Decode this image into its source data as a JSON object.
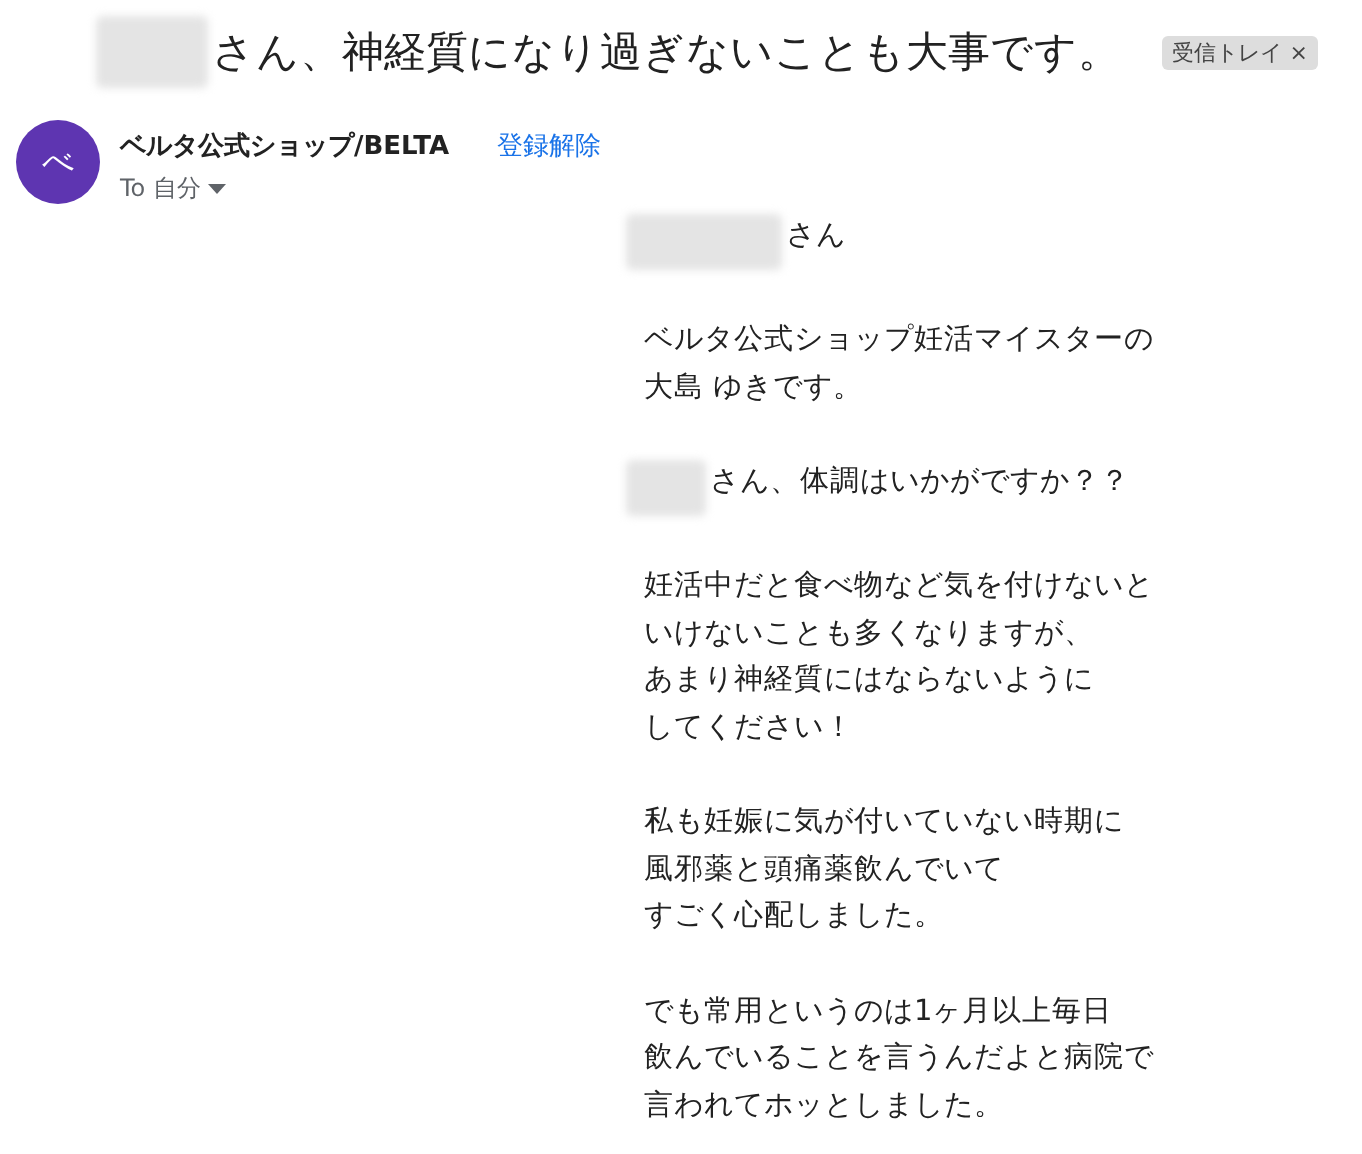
{
  "subject": {
    "redacted": true,
    "text": "さん、神経質になり過ぎないことも大事です。"
  },
  "label": {
    "text": "受信トレイ",
    "close": "×"
  },
  "sender": {
    "avatar": "べ",
    "name": "ベルタ公式ショップ/BELTA",
    "unsubscribe": "登録解除",
    "to": "To 自分"
  },
  "body": [
    {
      "redacted": true,
      "lines": [
        "さん"
      ]
    },
    {
      "redacted": false,
      "lines": [
        "ベルタ公式ショップ妊活マイスターの",
        "大島 ゆきです。"
      ]
    },
    {
      "redacted": true,
      "lines": [
        "さん、体調はいかがですか？？"
      ]
    },
    {
      "redacted": false,
      "lines": [
        "妊活中だと食べ物など気を付けないと",
        "いけないことも多くなりますが、",
        "あまり神経質にはならないように",
        "してください！"
      ]
    },
    {
      "redacted": false,
      "lines": [
        "私も妊娠に気が付いていない時期に",
        "風邪薬と頭痛薬飲んでいて",
        "すごく心配しました。"
      ]
    },
    {
      "redacted": false,
      "lines": [
        "でも常用というのは1ヶ月以上毎日",
        "飲んでいることを言うんだよと病院で",
        "言われてホッとしました。"
      ]
    }
  ]
}
